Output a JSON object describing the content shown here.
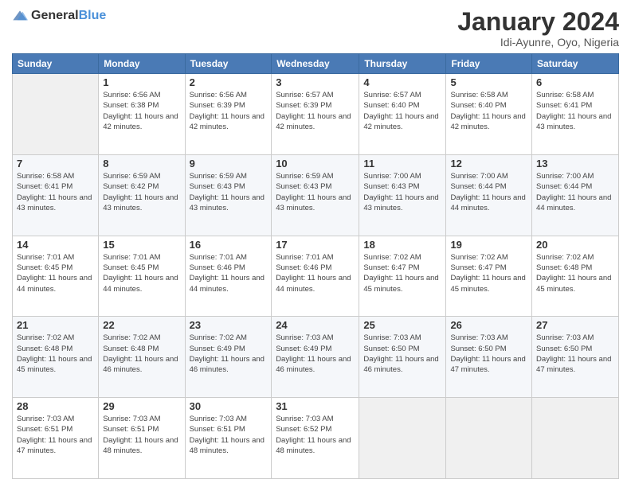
{
  "logo": {
    "general": "General",
    "blue": "Blue"
  },
  "calendar": {
    "title": "January 2024",
    "subtitle": "Idi-Ayunre, Oyo, Nigeria"
  },
  "headers": [
    "Sunday",
    "Monday",
    "Tuesday",
    "Wednesday",
    "Thursday",
    "Friday",
    "Saturday"
  ],
  "weeks": [
    [
      {
        "day": "",
        "sunrise": "",
        "sunset": "",
        "daylight": ""
      },
      {
        "day": "1",
        "sunrise": "Sunrise: 6:56 AM",
        "sunset": "Sunset: 6:38 PM",
        "daylight": "Daylight: 11 hours and 42 minutes."
      },
      {
        "day": "2",
        "sunrise": "Sunrise: 6:56 AM",
        "sunset": "Sunset: 6:39 PM",
        "daylight": "Daylight: 11 hours and 42 minutes."
      },
      {
        "day": "3",
        "sunrise": "Sunrise: 6:57 AM",
        "sunset": "Sunset: 6:39 PM",
        "daylight": "Daylight: 11 hours and 42 minutes."
      },
      {
        "day": "4",
        "sunrise": "Sunrise: 6:57 AM",
        "sunset": "Sunset: 6:40 PM",
        "daylight": "Daylight: 11 hours and 42 minutes."
      },
      {
        "day": "5",
        "sunrise": "Sunrise: 6:58 AM",
        "sunset": "Sunset: 6:40 PM",
        "daylight": "Daylight: 11 hours and 42 minutes."
      },
      {
        "day": "6",
        "sunrise": "Sunrise: 6:58 AM",
        "sunset": "Sunset: 6:41 PM",
        "daylight": "Daylight: 11 hours and 43 minutes."
      }
    ],
    [
      {
        "day": "7",
        "sunrise": "Sunrise: 6:58 AM",
        "sunset": "Sunset: 6:41 PM",
        "daylight": "Daylight: 11 hours and 43 minutes."
      },
      {
        "day": "8",
        "sunrise": "Sunrise: 6:59 AM",
        "sunset": "Sunset: 6:42 PM",
        "daylight": "Daylight: 11 hours and 43 minutes."
      },
      {
        "day": "9",
        "sunrise": "Sunrise: 6:59 AM",
        "sunset": "Sunset: 6:43 PM",
        "daylight": "Daylight: 11 hours and 43 minutes."
      },
      {
        "day": "10",
        "sunrise": "Sunrise: 6:59 AM",
        "sunset": "Sunset: 6:43 PM",
        "daylight": "Daylight: 11 hours and 43 minutes."
      },
      {
        "day": "11",
        "sunrise": "Sunrise: 7:00 AM",
        "sunset": "Sunset: 6:43 PM",
        "daylight": "Daylight: 11 hours and 43 minutes."
      },
      {
        "day": "12",
        "sunrise": "Sunrise: 7:00 AM",
        "sunset": "Sunset: 6:44 PM",
        "daylight": "Daylight: 11 hours and 44 minutes."
      },
      {
        "day": "13",
        "sunrise": "Sunrise: 7:00 AM",
        "sunset": "Sunset: 6:44 PM",
        "daylight": "Daylight: 11 hours and 44 minutes."
      }
    ],
    [
      {
        "day": "14",
        "sunrise": "Sunrise: 7:01 AM",
        "sunset": "Sunset: 6:45 PM",
        "daylight": "Daylight: 11 hours and 44 minutes."
      },
      {
        "day": "15",
        "sunrise": "Sunrise: 7:01 AM",
        "sunset": "Sunset: 6:45 PM",
        "daylight": "Daylight: 11 hours and 44 minutes."
      },
      {
        "day": "16",
        "sunrise": "Sunrise: 7:01 AM",
        "sunset": "Sunset: 6:46 PM",
        "daylight": "Daylight: 11 hours and 44 minutes."
      },
      {
        "day": "17",
        "sunrise": "Sunrise: 7:01 AM",
        "sunset": "Sunset: 6:46 PM",
        "daylight": "Daylight: 11 hours and 44 minutes."
      },
      {
        "day": "18",
        "sunrise": "Sunrise: 7:02 AM",
        "sunset": "Sunset: 6:47 PM",
        "daylight": "Daylight: 11 hours and 45 minutes."
      },
      {
        "day": "19",
        "sunrise": "Sunrise: 7:02 AM",
        "sunset": "Sunset: 6:47 PM",
        "daylight": "Daylight: 11 hours and 45 minutes."
      },
      {
        "day": "20",
        "sunrise": "Sunrise: 7:02 AM",
        "sunset": "Sunset: 6:48 PM",
        "daylight": "Daylight: 11 hours and 45 minutes."
      }
    ],
    [
      {
        "day": "21",
        "sunrise": "Sunrise: 7:02 AM",
        "sunset": "Sunset: 6:48 PM",
        "daylight": "Daylight: 11 hours and 45 minutes."
      },
      {
        "day": "22",
        "sunrise": "Sunrise: 7:02 AM",
        "sunset": "Sunset: 6:48 PM",
        "daylight": "Daylight: 11 hours and 46 minutes."
      },
      {
        "day": "23",
        "sunrise": "Sunrise: 7:02 AM",
        "sunset": "Sunset: 6:49 PM",
        "daylight": "Daylight: 11 hours and 46 minutes."
      },
      {
        "day": "24",
        "sunrise": "Sunrise: 7:03 AM",
        "sunset": "Sunset: 6:49 PM",
        "daylight": "Daylight: 11 hours and 46 minutes."
      },
      {
        "day": "25",
        "sunrise": "Sunrise: 7:03 AM",
        "sunset": "Sunset: 6:50 PM",
        "daylight": "Daylight: 11 hours and 46 minutes."
      },
      {
        "day": "26",
        "sunrise": "Sunrise: 7:03 AM",
        "sunset": "Sunset: 6:50 PM",
        "daylight": "Daylight: 11 hours and 47 minutes."
      },
      {
        "day": "27",
        "sunrise": "Sunrise: 7:03 AM",
        "sunset": "Sunset: 6:50 PM",
        "daylight": "Daylight: 11 hours and 47 minutes."
      }
    ],
    [
      {
        "day": "28",
        "sunrise": "Sunrise: 7:03 AM",
        "sunset": "Sunset: 6:51 PM",
        "daylight": "Daylight: 11 hours and 47 minutes."
      },
      {
        "day": "29",
        "sunrise": "Sunrise: 7:03 AM",
        "sunset": "Sunset: 6:51 PM",
        "daylight": "Daylight: 11 hours and 48 minutes."
      },
      {
        "day": "30",
        "sunrise": "Sunrise: 7:03 AM",
        "sunset": "Sunset: 6:51 PM",
        "daylight": "Daylight: 11 hours and 48 minutes."
      },
      {
        "day": "31",
        "sunrise": "Sunrise: 7:03 AM",
        "sunset": "Sunset: 6:52 PM",
        "daylight": "Daylight: 11 hours and 48 minutes."
      },
      {
        "day": "",
        "sunrise": "",
        "sunset": "",
        "daylight": ""
      },
      {
        "day": "",
        "sunrise": "",
        "sunset": "",
        "daylight": ""
      },
      {
        "day": "",
        "sunrise": "",
        "sunset": "",
        "daylight": ""
      }
    ]
  ]
}
